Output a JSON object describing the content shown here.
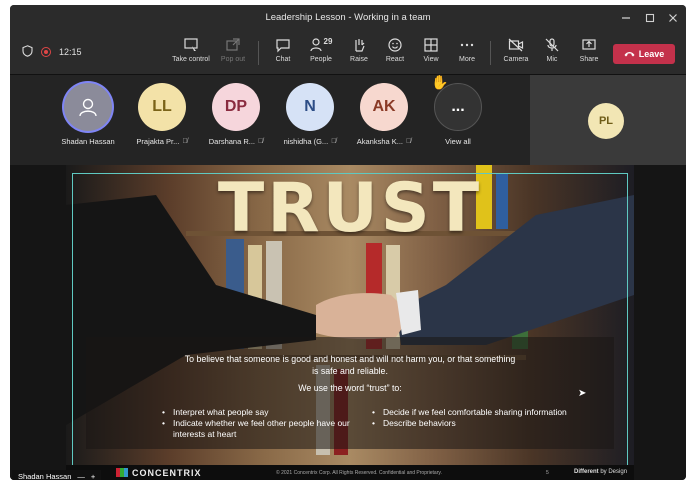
{
  "window": {
    "title": "Leadership Lesson - Working in a team"
  },
  "toolbar": {
    "timer": "12:15",
    "buttons": {
      "take_control": "Take control",
      "pop_out": "Pop out",
      "chat": "Chat",
      "people": "People",
      "people_count": "29",
      "raise": "Raise",
      "react": "React",
      "view": "View",
      "more": "More",
      "camera": "Camera",
      "mic": "Mic",
      "share": "Share"
    },
    "leave": "Leave"
  },
  "participants": [
    {
      "initials": "",
      "name": "Shadan Hassan",
      "bg": "#8b8b9a",
      "fg": "#ffffff"
    },
    {
      "initials": "LL",
      "name": "Prajakta Pr...",
      "bg": "#f3e2a8",
      "fg": "#7a6318"
    },
    {
      "initials": "DP",
      "name": "Darshana R...",
      "bg": "#f6d6dc",
      "fg": "#8a2b3f"
    },
    {
      "initials": "N",
      "name": "nishidha (G...",
      "bg": "#d6e2f6",
      "fg": "#2d4d86"
    },
    {
      "initials": "AK",
      "name": "Akanksha K...",
      "bg": "#f7d8cf",
      "fg": "#8a3a26"
    },
    {
      "initials": "...",
      "name": "View all",
      "bg": "#3a3a3a",
      "fg": "#ffffff"
    }
  ],
  "side_tile": {
    "initials": "PL"
  },
  "slide": {
    "title": "TRUST",
    "definition_line1": "To believe that someone is good and honest and will not harm you, or that something",
    "definition_line2": "is safe and reliable.",
    "use_word": "We use the word “trust” to:",
    "bullets_left": [
      "Interpret what people say",
      "Indicate whether we feel other people have our interests at heart"
    ],
    "bullets_right": [
      "Decide if we feel comfortable sharing information",
      "Describe behaviors"
    ],
    "footer": {
      "brand": "CONCENTRIX",
      "copyright": "© 2021 Concentrix Corp. All Rights Reserved. Confidential and Proprietary.",
      "page": "5",
      "tagline_a": "Different",
      "tagline_b": "by Design"
    }
  },
  "presenter": {
    "name": "Shadan Hassan"
  },
  "colors": {
    "leave": "#c4314b",
    "frame": "#5fc9c1",
    "recording": "#e04646"
  }
}
